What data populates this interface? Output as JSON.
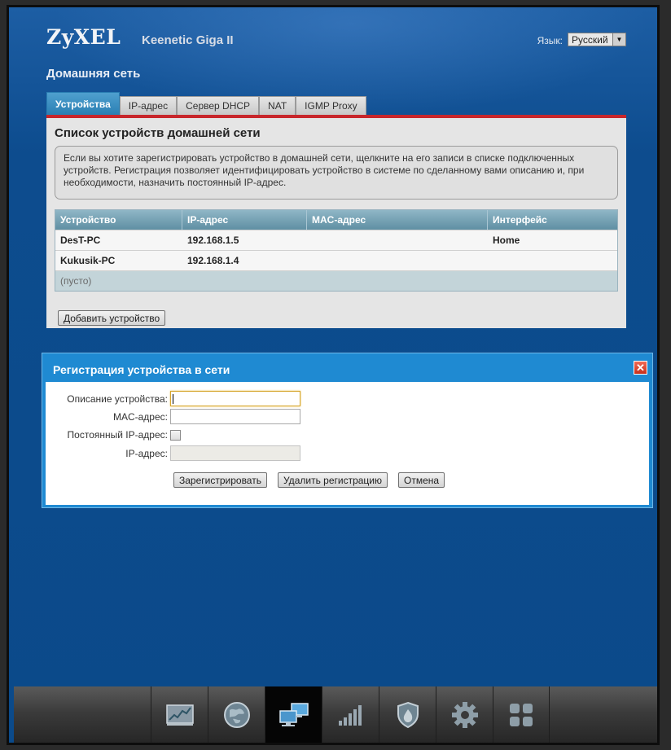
{
  "header": {
    "logo": "ZyXEL",
    "model": "Keenetic Giga II",
    "language_label": "Язык:",
    "language_value": "Русский"
  },
  "page": {
    "title": "Домашняя сеть"
  },
  "tabs": [
    {
      "label": "Устройства",
      "active": true
    },
    {
      "label": "IP-адрес",
      "active": false
    },
    {
      "label": "Сервер DHCP",
      "active": false
    },
    {
      "label": "NAT",
      "active": false
    },
    {
      "label": "IGMP Proxy",
      "active": false
    }
  ],
  "devices": {
    "title": "Список устройств домашней сети",
    "info": "Если вы хотите зарегистрировать устройство в домашней сети, щелкните на его записи в списке подключенных устройств. Регистрация позволяет идентифицировать устройство в системе по сделанному вами описанию и, при необходимости, назначить постоянный IP-адрес.",
    "columns": [
      "Устройство",
      "IP-адрес",
      "MAC-адрес",
      "Интерфейс"
    ],
    "rows": [
      {
        "device": "DesT-PC",
        "ip": "192.168.1.5",
        "mac": "",
        "interface": "Home"
      },
      {
        "device": "Kukusik-PC",
        "ip": "192.168.1.4",
        "mac": "",
        "interface": ""
      }
    ],
    "empty_label": "(пусто)",
    "add_button": "Добавить устройство"
  },
  "dialog": {
    "title": "Регистрация устройства в сети",
    "close_symbol": "✕",
    "fields": {
      "description_label": "Описание устройства:",
      "description_value": "",
      "mac_label": "MAC-адрес:",
      "mac_value": "",
      "static_ip_label": "Постоянный IP-адрес:",
      "static_ip_checked": false,
      "ip_label": "IP-адрес:",
      "ip_value": ""
    },
    "buttons": {
      "register": "Зарегистрировать",
      "unregister": "Удалить регистрацию",
      "cancel": "Отмена"
    }
  },
  "bottom_nav": [
    {
      "icon": "monitor-graph-icon",
      "active": false
    },
    {
      "icon": "globe-icon",
      "active": false
    },
    {
      "icon": "network-computers-icon",
      "active": true
    },
    {
      "icon": "signal-bars-icon",
      "active": false
    },
    {
      "icon": "shield-icon",
      "active": false
    },
    {
      "icon": "gear-icon",
      "active": false
    },
    {
      "icon": "apps-grid-icon",
      "active": false
    }
  ],
  "colors": {
    "frame_blue": "#0b4a8a",
    "tab_active": "#2a7fb3",
    "accent_red": "#c8262b",
    "dialog_blue": "#1f8ad2",
    "table_header": "#5f8fa3"
  }
}
